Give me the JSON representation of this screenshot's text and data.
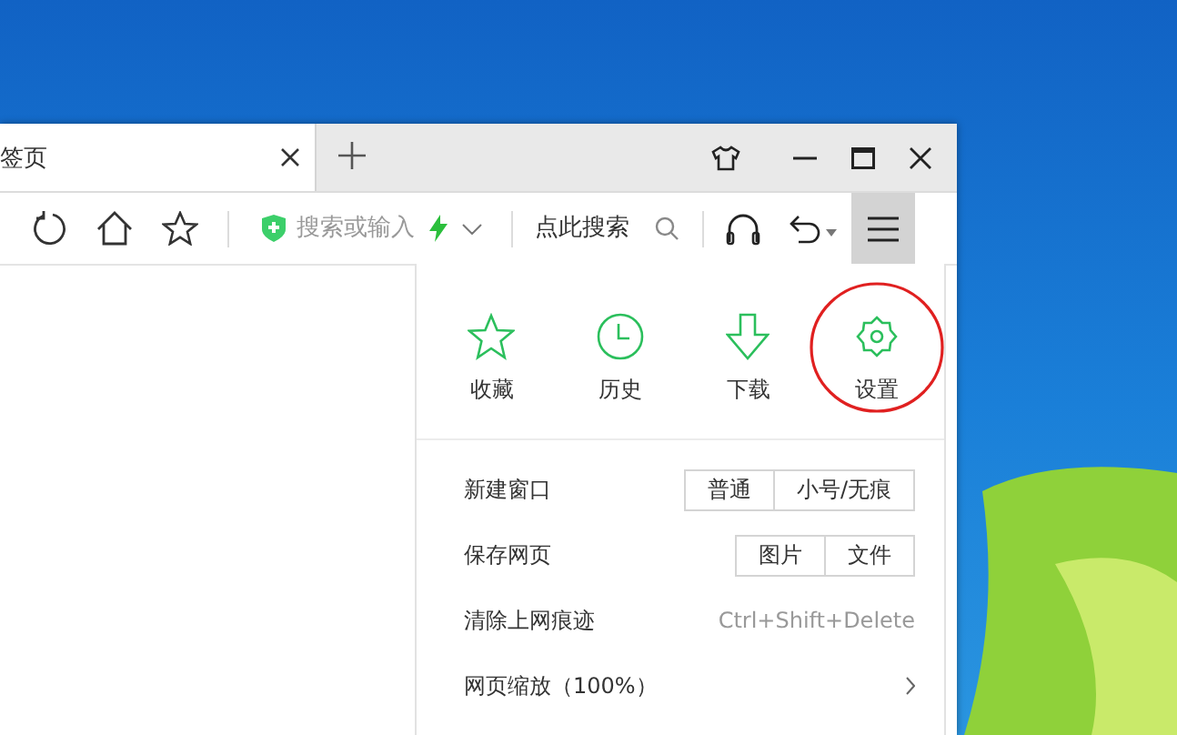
{
  "tabs": [
    {
      "label": "签页",
      "selected": true
    }
  ],
  "toolbar": {
    "address_placeholder": "搜索或输入",
    "search_placeholder": "点此搜索"
  },
  "menu": {
    "quick_items": [
      {
        "label": "收藏",
        "circled": false
      },
      {
        "label": "历史",
        "circled": false
      },
      {
        "label": "下载",
        "circled": false
      },
      {
        "label": "设置",
        "circled": true
      }
    ],
    "rows": [
      {
        "kind": "buttons",
        "label": "新建窗口",
        "buttons": [
          "普通",
          "小号/无痕"
        ]
      },
      {
        "kind": "buttons",
        "label": "保存网页",
        "buttons": [
          "图片",
          "文件"
        ]
      },
      {
        "kind": "shortcut",
        "label": "清除上网痕迹",
        "shortcut": "Ctrl+Shift+Delete"
      },
      {
        "kind": "submenu",
        "label": "网页缩放（100%）"
      }
    ]
  }
}
